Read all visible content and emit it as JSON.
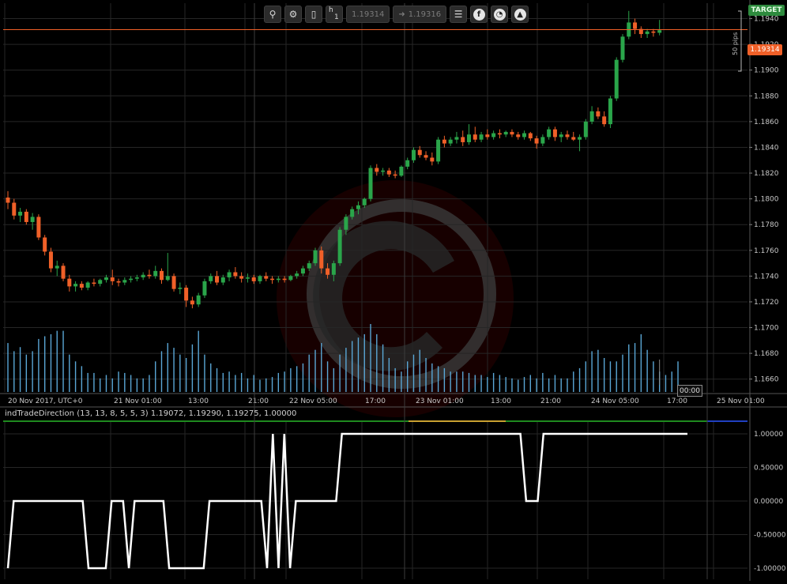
{
  "toolbar": {
    "period_label": "h",
    "period_value": "1",
    "sell_price": "1.19314",
    "buy_price": "1.19316",
    "circle_icons": [
      {
        "name": "facebook-icon",
        "glyph": "f"
      },
      {
        "name": "calendar-icon",
        "glyph": "◔"
      },
      {
        "name": "hat-icon",
        "glyph": "▲"
      }
    ]
  },
  "target_label": "TARGET",
  "pips_label": "50 pips",
  "current_price_label": "1.19314",
  "current_time_label": "00:00",
  "indicator": {
    "title": "indTradeDirection (13, 13, 8, 5, 5, 3) 1.19072, 1.19290, 1.19275, 1.00000"
  },
  "colors": {
    "background": "#000000",
    "bull": "#2aa54a",
    "bear": "#f06028",
    "volume": "#5aa7d6",
    "grid": "#262626",
    "price_line": "#f06028",
    "target": "#2e8b3e",
    "indicator_line": "#ffffff"
  },
  "chart_data": [
    {
      "type": "candlestick",
      "title": "",
      "x_tick_labels": [
        "20 Nov 2017, UTC+0",
        "21 Nov 01:00",
        "13:00",
        "21:00",
        "22 Nov 05:00",
        "17:00",
        "23 Nov 01:00",
        "13:00",
        "21:00",
        "24 Nov 05:00",
        "17:00",
        "25 Nov 01:00"
      ],
      "y_tick_labels": [
        "1.1940",
        "1.1920",
        "1.1900",
        "1.1880",
        "1.1860",
        "1.1840",
        "1.1820",
        "1.1800",
        "1.1780",
        "1.1760",
        "1.1740",
        "1.1720",
        "1.1700",
        "1.1680",
        "1.1660"
      ],
      "ylim": [
        1.165,
        1.1952
      ],
      "current_price": 1.19314,
      "grid": true,
      "candles": [
        {
          "o": 1.1801,
          "h": 1.1806,
          "l": 1.1792,
          "c": 1.1797
        },
        {
          "o": 1.1797,
          "h": 1.18,
          "l": 1.1784,
          "c": 1.1787
        },
        {
          "o": 1.1787,
          "h": 1.1793,
          "l": 1.1782,
          "c": 1.179
        },
        {
          "o": 1.179,
          "h": 1.1792,
          "l": 1.178,
          "c": 1.1782
        },
        {
          "o": 1.1782,
          "h": 1.1789,
          "l": 1.1776,
          "c": 1.1786
        },
        {
          "o": 1.1786,
          "h": 1.1788,
          "l": 1.1768,
          "c": 1.177
        },
        {
          "o": 1.177,
          "h": 1.1772,
          "l": 1.1756,
          "c": 1.1759
        },
        {
          "o": 1.1759,
          "h": 1.1762,
          "l": 1.1743,
          "c": 1.1746
        },
        {
          "o": 1.1746,
          "h": 1.1752,
          "l": 1.174,
          "c": 1.1748
        },
        {
          "o": 1.1748,
          "h": 1.175,
          "l": 1.1736,
          "c": 1.1738
        },
        {
          "o": 1.1738,
          "h": 1.1741,
          "l": 1.1728,
          "c": 1.1732
        },
        {
          "o": 1.1732,
          "h": 1.1736,
          "l": 1.1728,
          "c": 1.1734
        },
        {
          "o": 1.1734,
          "h": 1.1736,
          "l": 1.1729,
          "c": 1.1731
        },
        {
          "o": 1.1731,
          "h": 1.1736,
          "l": 1.1729,
          "c": 1.1735
        },
        {
          "o": 1.1735,
          "h": 1.1738,
          "l": 1.1732,
          "c": 1.1734
        },
        {
          "o": 1.1734,
          "h": 1.1738,
          "l": 1.1732,
          "c": 1.1737
        },
        {
          "o": 1.1737,
          "h": 1.1741,
          "l": 1.1735,
          "c": 1.1739
        },
        {
          "o": 1.1739,
          "h": 1.1745,
          "l": 1.1733,
          "c": 1.1736
        },
        {
          "o": 1.1736,
          "h": 1.1738,
          "l": 1.1732,
          "c": 1.1735
        },
        {
          "o": 1.1735,
          "h": 1.1739,
          "l": 1.1733,
          "c": 1.1737
        },
        {
          "o": 1.1737,
          "h": 1.174,
          "l": 1.1735,
          "c": 1.1738
        },
        {
          "o": 1.1738,
          "h": 1.1741,
          "l": 1.1736,
          "c": 1.1739
        },
        {
          "o": 1.1739,
          "h": 1.1743,
          "l": 1.1737,
          "c": 1.1741
        },
        {
          "o": 1.1741,
          "h": 1.1745,
          "l": 1.1738,
          "c": 1.174
        },
        {
          "o": 1.174,
          "h": 1.1748,
          "l": 1.1738,
          "c": 1.1744
        },
        {
          "o": 1.1744,
          "h": 1.1746,
          "l": 1.1734,
          "c": 1.1737
        },
        {
          "o": 1.1737,
          "h": 1.1758,
          "l": 1.1736,
          "c": 1.174
        },
        {
          "o": 1.174,
          "h": 1.1742,
          "l": 1.1728,
          "c": 1.173
        },
        {
          "o": 1.173,
          "h": 1.1735,
          "l": 1.1726,
          "c": 1.1731
        },
        {
          "o": 1.1731,
          "h": 1.1733,
          "l": 1.1716,
          "c": 1.1721
        },
        {
          "o": 1.1721,
          "h": 1.1724,
          "l": 1.1715,
          "c": 1.1718
        },
        {
          "o": 1.1718,
          "h": 1.1727,
          "l": 1.1716,
          "c": 1.1725
        },
        {
          "o": 1.1725,
          "h": 1.1738,
          "l": 1.1723,
          "c": 1.1736
        },
        {
          "o": 1.1736,
          "h": 1.1742,
          "l": 1.1734,
          "c": 1.174
        },
        {
          "o": 1.174,
          "h": 1.1744,
          "l": 1.1733,
          "c": 1.1735
        },
        {
          "o": 1.1735,
          "h": 1.1741,
          "l": 1.1733,
          "c": 1.1739
        },
        {
          "o": 1.1739,
          "h": 1.1745,
          "l": 1.1736,
          "c": 1.1743
        },
        {
          "o": 1.1743,
          "h": 1.1747,
          "l": 1.1738,
          "c": 1.174
        },
        {
          "o": 1.174,
          "h": 1.1743,
          "l": 1.1735,
          "c": 1.1738
        },
        {
          "o": 1.1738,
          "h": 1.1742,
          "l": 1.1735,
          "c": 1.1739
        },
        {
          "o": 1.1739,
          "h": 1.1741,
          "l": 1.1734,
          "c": 1.1736
        },
        {
          "o": 1.1736,
          "h": 1.1741,
          "l": 1.1734,
          "c": 1.174
        },
        {
          "o": 1.174,
          "h": 1.1743,
          "l": 1.1736,
          "c": 1.1738
        },
        {
          "o": 1.1738,
          "h": 1.174,
          "l": 1.1734,
          "c": 1.1737
        },
        {
          "o": 1.1737,
          "h": 1.174,
          "l": 1.1735,
          "c": 1.1738
        },
        {
          "o": 1.1738,
          "h": 1.174,
          "l": 1.1735,
          "c": 1.1737
        },
        {
          "o": 1.1737,
          "h": 1.1741,
          "l": 1.1736,
          "c": 1.174
        },
        {
          "o": 1.174,
          "h": 1.1744,
          "l": 1.1738,
          "c": 1.1742
        },
        {
          "o": 1.1742,
          "h": 1.1748,
          "l": 1.174,
          "c": 1.1746
        },
        {
          "o": 1.1746,
          "h": 1.1752,
          "l": 1.1744,
          "c": 1.175
        },
        {
          "o": 1.175,
          "h": 1.1762,
          "l": 1.1748,
          "c": 1.176
        },
        {
          "o": 1.176,
          "h": 1.1763,
          "l": 1.1742,
          "c": 1.1746
        },
        {
          "o": 1.1746,
          "h": 1.175,
          "l": 1.1738,
          "c": 1.1741
        },
        {
          "o": 1.1741,
          "h": 1.1752,
          "l": 1.1736,
          "c": 1.175
        },
        {
          "o": 1.175,
          "h": 1.1778,
          "l": 1.1748,
          "c": 1.1776
        },
        {
          "o": 1.1776,
          "h": 1.1788,
          "l": 1.1772,
          "c": 1.1786
        },
        {
          "o": 1.1786,
          "h": 1.1794,
          "l": 1.1784,
          "c": 1.1792
        },
        {
          "o": 1.1792,
          "h": 1.1798,
          "l": 1.1788,
          "c": 1.1795
        },
        {
          "o": 1.1795,
          "h": 1.1801,
          "l": 1.1793,
          "c": 1.18
        },
        {
          "o": 1.18,
          "h": 1.1826,
          "l": 1.1798,
          "c": 1.1824
        },
        {
          "o": 1.1824,
          "h": 1.1827,
          "l": 1.1818,
          "c": 1.1821
        },
        {
          "o": 1.1821,
          "h": 1.1824,
          "l": 1.1818,
          "c": 1.1822
        },
        {
          "o": 1.1822,
          "h": 1.1824,
          "l": 1.1817,
          "c": 1.1819
        },
        {
          "o": 1.1819,
          "h": 1.1822,
          "l": 1.1816,
          "c": 1.1818
        },
        {
          "o": 1.1818,
          "h": 1.1826,
          "l": 1.1817,
          "c": 1.1825
        },
        {
          "o": 1.1825,
          "h": 1.1832,
          "l": 1.1823,
          "c": 1.183
        },
        {
          "o": 1.183,
          "h": 1.184,
          "l": 1.1828,
          "c": 1.1838
        },
        {
          "o": 1.1838,
          "h": 1.1841,
          "l": 1.1832,
          "c": 1.1834
        },
        {
          "o": 1.1834,
          "h": 1.1837,
          "l": 1.183,
          "c": 1.1832
        },
        {
          "o": 1.1832,
          "h": 1.1836,
          "l": 1.1826,
          "c": 1.1829
        },
        {
          "o": 1.1829,
          "h": 1.1848,
          "l": 1.1827,
          "c": 1.1846
        },
        {
          "o": 1.1846,
          "h": 1.1849,
          "l": 1.184,
          "c": 1.1843
        },
        {
          "o": 1.1843,
          "h": 1.1848,
          "l": 1.1841,
          "c": 1.1846
        },
        {
          "o": 1.1846,
          "h": 1.1852,
          "l": 1.1843,
          "c": 1.1848
        },
        {
          "o": 1.1848,
          "h": 1.1853,
          "l": 1.1841,
          "c": 1.1844
        },
        {
          "o": 1.1844,
          "h": 1.1858,
          "l": 1.1842,
          "c": 1.185
        },
        {
          "o": 1.185,
          "h": 1.1856,
          "l": 1.1844,
          "c": 1.1846
        },
        {
          "o": 1.1846,
          "h": 1.1852,
          "l": 1.1844,
          "c": 1.185
        },
        {
          "o": 1.185,
          "h": 1.1854,
          "l": 1.1846,
          "c": 1.1848
        },
        {
          "o": 1.1848,
          "h": 1.1853,
          "l": 1.1846,
          "c": 1.1851
        },
        {
          "o": 1.1851,
          "h": 1.1854,
          "l": 1.1847,
          "c": 1.185
        },
        {
          "o": 1.185,
          "h": 1.1853,
          "l": 1.1848,
          "c": 1.1852
        },
        {
          "o": 1.1852,
          "h": 1.1854,
          "l": 1.1848,
          "c": 1.185
        },
        {
          "o": 1.185,
          "h": 1.1852,
          "l": 1.1846,
          "c": 1.1848
        },
        {
          "o": 1.1848,
          "h": 1.1853,
          "l": 1.1846,
          "c": 1.1851
        },
        {
          "o": 1.1851,
          "h": 1.1852,
          "l": 1.1845,
          "c": 1.1847
        },
        {
          "o": 1.1847,
          "h": 1.1849,
          "l": 1.1839,
          "c": 1.1843
        },
        {
          "o": 1.1843,
          "h": 1.185,
          "l": 1.1841,
          "c": 1.1848
        },
        {
          "o": 1.1848,
          "h": 1.1856,
          "l": 1.1846,
          "c": 1.1854
        },
        {
          "o": 1.1854,
          "h": 1.1856,
          "l": 1.1845,
          "c": 1.1848
        },
        {
          "o": 1.1848,
          "h": 1.1852,
          "l": 1.1844,
          "c": 1.185
        },
        {
          "o": 1.185,
          "h": 1.1853,
          "l": 1.1846,
          "c": 1.1848
        },
        {
          "o": 1.1848,
          "h": 1.1852,
          "l": 1.1845,
          "c": 1.1846
        },
        {
          "o": 1.1846,
          "h": 1.185,
          "l": 1.1837,
          "c": 1.1848
        },
        {
          "o": 1.1848,
          "h": 1.1862,
          "l": 1.1846,
          "c": 1.186
        },
        {
          "o": 1.186,
          "h": 1.1872,
          "l": 1.1858,
          "c": 1.1868
        },
        {
          "o": 1.1868,
          "h": 1.1871,
          "l": 1.1862,
          "c": 1.1864
        },
        {
          "o": 1.1864,
          "h": 1.1868,
          "l": 1.1856,
          "c": 1.1858
        },
        {
          "o": 1.1858,
          "h": 1.188,
          "l": 1.1855,
          "c": 1.1878
        },
        {
          "o": 1.1878,
          "h": 1.191,
          "l": 1.1876,
          "c": 1.1908
        },
        {
          "o": 1.1908,
          "h": 1.1928,
          "l": 1.1906,
          "c": 1.1926
        },
        {
          "o": 1.1926,
          "h": 1.1946,
          "l": 1.1924,
          "c": 1.1937
        },
        {
          "o": 1.1937,
          "h": 1.194,
          "l": 1.1928,
          "c": 1.1932
        },
        {
          "o": 1.1932,
          "h": 1.1934,
          "l": 1.1925,
          "c": 1.1928
        },
        {
          "o": 1.1928,
          "h": 1.1932,
          "l": 1.1925,
          "c": 1.193
        },
        {
          "o": 1.193,
          "h": 1.1932,
          "l": 1.1926,
          "c": 1.1929
        },
        {
          "o": 1.1929,
          "h": 1.1939,
          "l": 1.1927,
          "c": 1.1931
        }
      ],
      "volume": [
        0.72,
        0.6,
        0.66,
        0.55,
        0.6,
        0.78,
        0.82,
        0.85,
        0.9,
        0.9,
        0.55,
        0.45,
        0.38,
        0.28,
        0.28,
        0.2,
        0.25,
        0.2,
        0.3,
        0.28,
        0.25,
        0.2,
        0.2,
        0.25,
        0.45,
        0.6,
        0.72,
        0.65,
        0.55,
        0.5,
        0.7,
        0.9,
        0.55,
        0.42,
        0.35,
        0.28,
        0.3,
        0.25,
        0.28,
        0.2,
        0.25,
        0.18,
        0.2,
        0.22,
        0.28,
        0.3,
        0.35,
        0.38,
        0.42,
        0.55,
        0.62,
        0.72,
        0.45,
        0.35,
        0.55,
        0.65,
        0.75,
        0.8,
        0.85,
        1.0,
        0.85,
        0.7,
        0.5,
        0.35,
        0.3,
        0.45,
        0.55,
        0.62,
        0.5,
        0.42,
        0.38,
        0.35,
        0.3,
        0.3,
        0.3,
        0.28,
        0.25,
        0.25,
        0.22,
        0.28,
        0.25,
        0.22,
        0.2,
        0.18,
        0.22,
        0.25,
        0.2,
        0.28,
        0.2,
        0.25,
        0.2,
        0.2,
        0.3,
        0.35,
        0.45,
        0.6,
        0.62,
        0.5,
        0.45,
        0.45,
        0.55,
        0.7,
        0.72,
        0.85,
        0.62,
        0.45,
        0.3,
        0.25,
        0.3,
        0.45
      ]
    },
    {
      "type": "line",
      "title": "indTradeDirection (13, 13, 8, 5, 5, 3) 1.19072, 1.19290, 1.19275, 1.00000",
      "y_tick_labels": [
        "1.00000",
        "0.50000",
        "0.00000",
        "-0.50000",
        "-1.00000"
      ],
      "ylim": [
        -1.1,
        1.1
      ],
      "series": [
        {
          "values": [
            -1,
            0,
            0,
            0,
            0,
            0,
            0,
            0,
            0,
            0,
            0,
            0,
            0,
            0,
            -1,
            -1,
            -1,
            -1,
            0,
            0,
            0,
            -1,
            0,
            0,
            0,
            0,
            0,
            0,
            -1,
            -1,
            -1,
            -1,
            -1,
            -1,
            -1,
            0,
            0,
            0,
            0,
            0,
            0,
            0,
            0,
            0,
            0,
            -1,
            1,
            -1,
            1,
            -1,
            0,
            0,
            0,
            0,
            0,
            0,
            0,
            0,
            1,
            1,
            1,
            1,
            1,
            1,
            1,
            1,
            1,
            1,
            1,
            1,
            1,
            1,
            1,
            1,
            1,
            1,
            1,
            1,
            1,
            1,
            1,
            1,
            1,
            1,
            1,
            1,
            1,
            1,
            1,
            1,
            0,
            0,
            0,
            1,
            1,
            1,
            1,
            1,
            1,
            1,
            1,
            1,
            1,
            1,
            1,
            1,
            1,
            1,
            1,
            1,
            1,
            1,
            1,
            1,
            1,
            1,
            1,
            1,
            1
          ]
        }
      ]
    }
  ]
}
